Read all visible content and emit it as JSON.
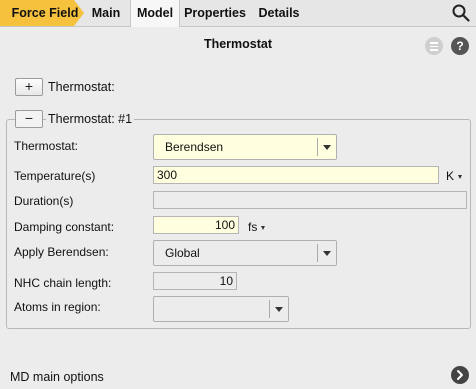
{
  "tabs": {
    "force_field": "Force Field",
    "main": "Main",
    "model": "Model",
    "properties": "Properties",
    "details": "Details"
  },
  "panel": {
    "title": "Thermostat"
  },
  "sections": {
    "collapsed_label": "Thermostat:",
    "expanded_label": "Thermostat: #1",
    "expand_glyph": "+",
    "collapse_glyph": "−"
  },
  "form": {
    "thermostat": {
      "label": "Thermostat:",
      "value": "Berendsen"
    },
    "temperature": {
      "label": "Temperature(s)",
      "value": "300",
      "unit": "K"
    },
    "duration": {
      "label": "Duration(s)",
      "value": ""
    },
    "damping": {
      "label": "Damping constant:",
      "value": "100",
      "unit": "fs"
    },
    "apply": {
      "label": "Apply Berendsen:",
      "value": "Global"
    },
    "nhc": {
      "label": "NHC chain length:",
      "value": "10"
    },
    "atoms": {
      "label": "Atoms in region:",
      "value": ""
    }
  },
  "footer": {
    "label": "MD main options"
  },
  "icons": {
    "search": "search-icon",
    "menu": "menu-icon",
    "help": "help-icon",
    "next": "chevron-right-icon"
  },
  "colors": {
    "accent": "#f6c23e",
    "input_yellow": "#ffffe0",
    "background": "#ececec"
  }
}
